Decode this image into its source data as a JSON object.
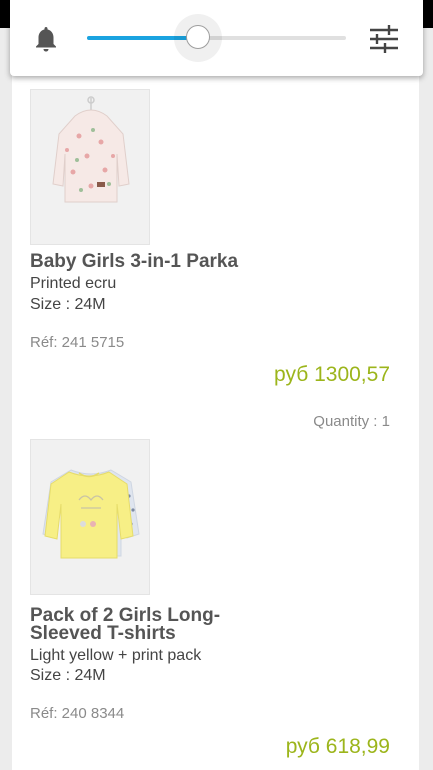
{
  "volume_panel": {
    "level_fraction": 0.43,
    "accent_color": "#1aa3e0",
    "left_icon": "bell-icon",
    "right_icon": "tune-sliders-icon"
  },
  "cart": {
    "items": [
      {
        "name": "Baby Girls 3-in-1 Parka",
        "variant": "Printed ecru",
        "size": "Size : 24M",
        "ref": "Réf: 241 5715",
        "price": "руб 1300,57",
        "quantity": "Quantity : 1"
      },
      {
        "name": "Pack of 2 Girls Long-Sleeved T-shirts",
        "variant": "Light yellow + print pack",
        "size": "Size : 24M",
        "ref": "Réf: 240 8344",
        "price": "руб 618,99"
      }
    ],
    "price_color": "#9cb51b"
  }
}
